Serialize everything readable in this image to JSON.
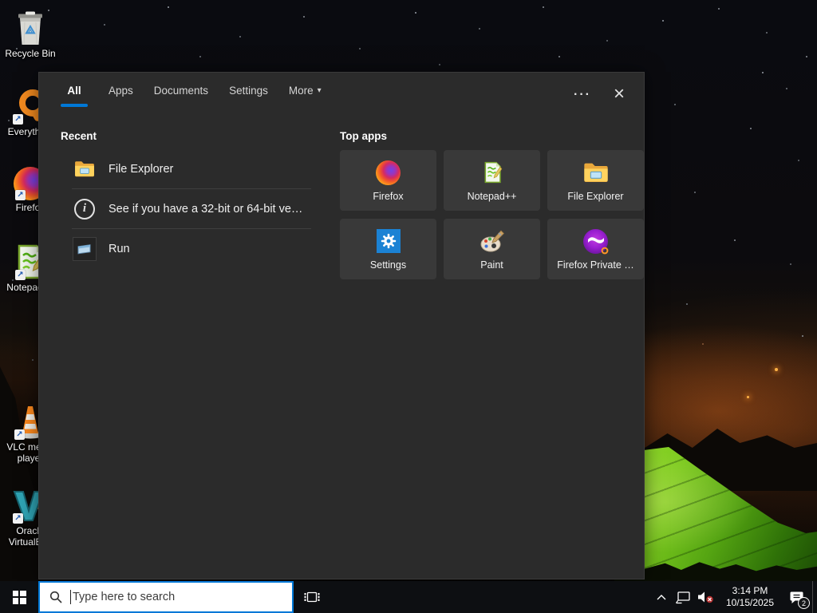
{
  "desktop": {
    "icons": [
      {
        "label": "Recycle Bin"
      },
      {
        "label": "Everything"
      },
      {
        "label": "Firefox"
      },
      {
        "label": "Notepad++"
      },
      {
        "label": "VLC media player"
      },
      {
        "label": "Oracle VirtualBox"
      }
    ]
  },
  "glyphs": {
    "shortcut_arrow": "↗",
    "more_dropdown": "▾",
    "options_ellipsis": "···",
    "close": "×",
    "info": "i",
    "chevron_up": "︿"
  },
  "search_panel": {
    "tabs": [
      "All",
      "Apps",
      "Documents",
      "Settings",
      "More"
    ],
    "active_tab": "All",
    "recent": {
      "heading": "Recent",
      "items": [
        {
          "label": "File Explorer"
        },
        {
          "label": "See if you have a 32-bit or 64-bit ve…"
        },
        {
          "label": "Run"
        }
      ]
    },
    "top_apps": {
      "heading": "Top apps",
      "items": [
        {
          "label": "Firefox"
        },
        {
          "label": "Notepad++"
        },
        {
          "label": "File Explorer"
        },
        {
          "label": "Settings"
        },
        {
          "label": "Paint"
        },
        {
          "label": "Firefox Private …"
        }
      ]
    }
  },
  "taskbar": {
    "search": {
      "placeholder": "Type here to search"
    },
    "tray": {
      "time": "3:14 PM",
      "date": "10/15/2025",
      "notification_count": "2"
    }
  },
  "colors": {
    "accent": "#0078d7",
    "panel_bg": "#2b2b2b",
    "tile_bg": "#393939",
    "taskbar_bg": "#0d0f12"
  }
}
